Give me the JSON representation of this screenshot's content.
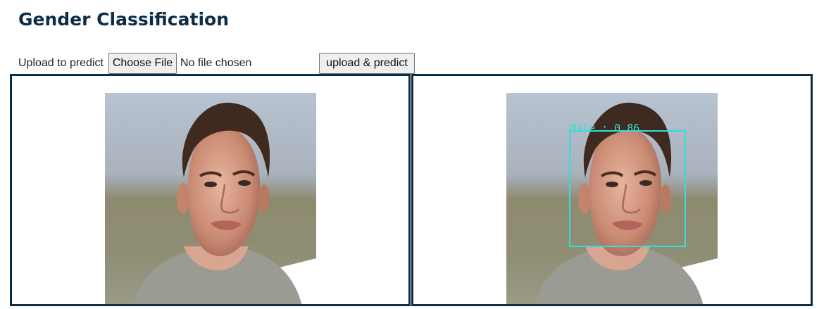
{
  "page": {
    "title": "Gender Classification"
  },
  "upload": {
    "label": "Upload to predict",
    "choose_file_label": "Choose File",
    "file_status": "No file chosen",
    "predict_label": "upload & predict"
  },
  "prediction": {
    "label_text": "Male : 0.86",
    "box_color": "#30e0d8"
  },
  "colors": {
    "title": "#0d2d46",
    "panel_border": "#0d2d46"
  }
}
